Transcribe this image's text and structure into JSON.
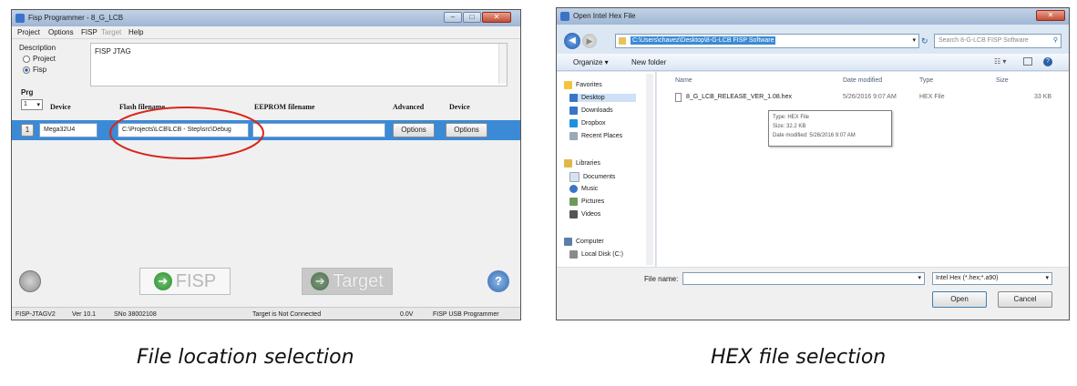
{
  "left_window": {
    "title": "Fisp Programmer - 8_G_LCB",
    "menu": [
      "Project",
      "Options",
      "FISP",
      "Target",
      "Help"
    ],
    "description_label": "Description",
    "radio_project": "Project",
    "radio_fisp": "Fisp",
    "description_text": "FISP JTAG",
    "prg_label": "Prg",
    "prg_select": "1",
    "headers": {
      "device": "Device",
      "flash": "Flash filename",
      "eeprom": "EEPROM filename",
      "advanced": "Advanced",
      "device2": "Device"
    },
    "row": {
      "index": "1",
      "device": "Mega32U4",
      "flash": "C:\\Projects\\LCB\\LCB - Step\\src\\Debug",
      "advanced_button": "Options",
      "device_button": "Options"
    },
    "fisp_button": "FISP",
    "target_button": "Target",
    "status": [
      "FISP-JTAGV2",
      "Ver 10.1",
      "SNo 38002108",
      "Target is Not Connected",
      "0.0V",
      "FISP USB Programmer"
    ]
  },
  "right_window": {
    "title": "Open Intel Hex File",
    "address": "C:\\Users\\chavez\\Desktop\\8-G-LCB FISP Software",
    "search_placeholder": "Search 8-G-LCB FISP Software",
    "organize": "Organize ▾",
    "new_folder": "New folder",
    "nav": {
      "favorites": "Favorites",
      "desktop": "Desktop",
      "downloads": "Downloads",
      "dropbox": "Dropbox",
      "recent": "Recent Places",
      "libraries": "Libraries",
      "documents": "Documents",
      "music": "Music",
      "pictures": "Pictures",
      "videos": "Videos",
      "computer": "Computer",
      "local_disk": "Local Disk (C:)"
    },
    "columns": {
      "name": "Name",
      "date": "Date modified",
      "type": "Type",
      "size": "Size"
    },
    "file": {
      "name": "8_G_LCB_RELEASE_VER_1.08.hex",
      "date": "5/26/2016 9:07 AM",
      "type": "HEX File",
      "size": "33 KB"
    },
    "tooltip": {
      "type": "Type: HEX File",
      "size": "Size: 32.2 KB",
      "date": "Date modified: 5/26/2016 9:07 AM"
    },
    "file_name_label": "File name:",
    "file_type": "Intel Hex (*.hex;*.a90)",
    "open_button": "Open",
    "cancel_button": "Cancel"
  },
  "captions": {
    "left": "File location selection",
    "right": "HEX file selection"
  },
  "colors": {
    "selection_blue": "#3b8ad6",
    "highlight_red": "#d9261c"
  }
}
